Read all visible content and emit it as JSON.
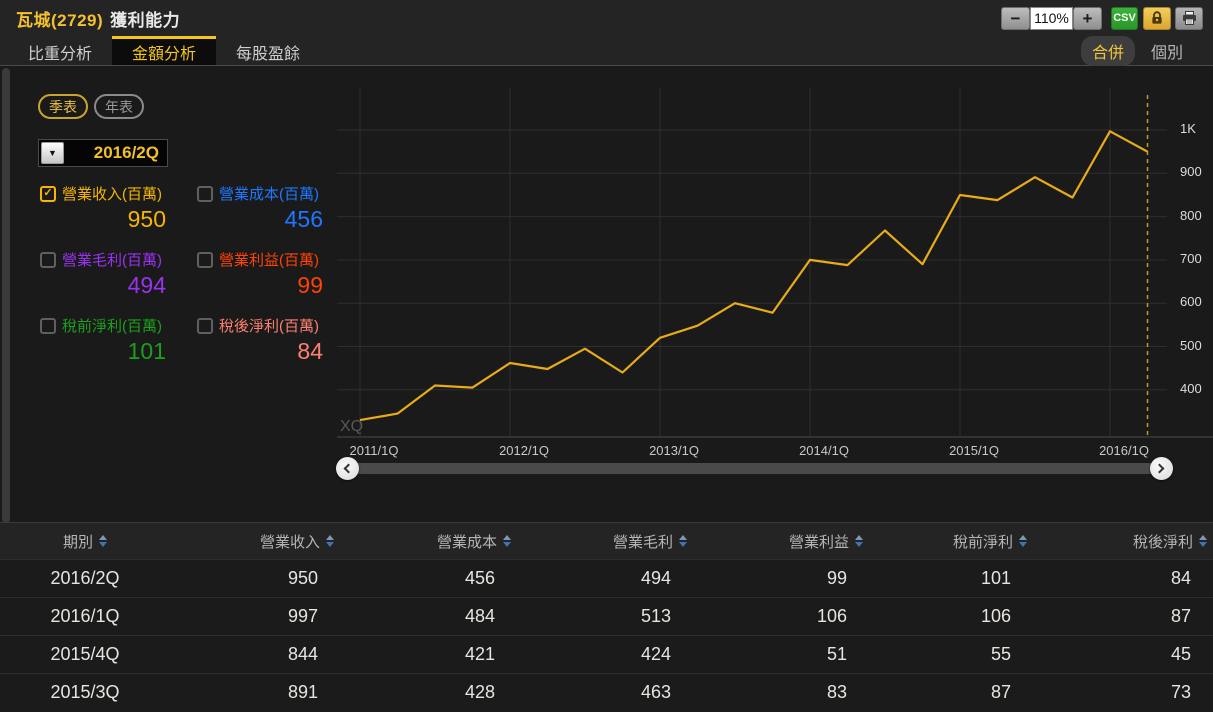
{
  "header": {
    "stock_name": "瓦城(2729)",
    "page_title": "獲利能力",
    "zoom_out": "−",
    "zoom_level": "110%",
    "zoom_in": "+",
    "csv_label": "CSV"
  },
  "tabs": [
    {
      "label": "比重分析",
      "active": false
    },
    {
      "label": "金額分析",
      "active": true
    },
    {
      "label": "每股盈餘",
      "active": false
    }
  ],
  "scope": {
    "merged": "合併",
    "individual": "個別"
  },
  "view_toggle": {
    "quarterly": "季表",
    "yearly": "年表"
  },
  "period_dropdown": {
    "value": "2016/2Q",
    "caret": "▼"
  },
  "check_glyph": "✓",
  "metrics": [
    {
      "label": "營業收入(百萬)",
      "value": "950",
      "color": "#f7b500",
      "checked": true
    },
    {
      "label": "營業成本(百萬)",
      "value": "456",
      "color": "#1e78ff",
      "checked": false
    },
    {
      "label": "營業毛利(百萬)",
      "value": "494",
      "color": "#9a32f0",
      "checked": false
    },
    {
      "label": "營業利益(百萬)",
      "value": "99",
      "color": "#ff4206",
      "checked": false
    },
    {
      "label": "稅前淨利(百萬)",
      "value": "101",
      "color": "#1aa01a",
      "checked": false
    },
    {
      "label": "稅後淨利(百萬)",
      "value": "84",
      "color": "#ff8070",
      "checked": false
    }
  ],
  "chart_data": {
    "type": "line",
    "watermark": "XQ",
    "grid": true,
    "x": [
      "2011/1Q",
      "2011/2Q",
      "2011/3Q",
      "2011/4Q",
      "2012/1Q",
      "2012/2Q",
      "2012/3Q",
      "2012/4Q",
      "2013/1Q",
      "2013/2Q",
      "2013/3Q",
      "2013/4Q",
      "2014/1Q",
      "2014/2Q",
      "2014/3Q",
      "2014/4Q",
      "2015/1Q",
      "2015/2Q",
      "2015/3Q",
      "2015/4Q",
      "2016/1Q",
      "2016/2Q"
    ],
    "series": [
      {
        "name": "營業收入(百萬)",
        "color": "#e9ab17",
        "values": [
          330,
          345,
          410,
          405,
          462,
          448,
          495,
          440,
          520,
          548,
          600,
          578,
          700,
          688,
          768,
          690,
          850,
          838,
          891,
          844,
          997,
          950
        ]
      }
    ],
    "x_ticks": [
      {
        "label": "2011/1Q",
        "index": 0
      },
      {
        "label": "2012/1Q",
        "index": 4
      },
      {
        "label": "2013/1Q",
        "index": 8
      },
      {
        "label": "2014/1Q",
        "index": 12
      },
      {
        "label": "2015/1Q",
        "index": 16
      },
      {
        "label": "2016/1Q",
        "index": 20
      }
    ],
    "y_axis": [
      {
        "label": "1K",
        "value": 1000
      },
      {
        "label": "900",
        "value": 900
      },
      {
        "label": "800",
        "value": 800
      },
      {
        "label": "700",
        "value": 700
      },
      {
        "label": "600",
        "value": 600
      },
      {
        "label": "500",
        "value": 500
      },
      {
        "label": "400",
        "value": 400
      }
    ],
    "ylim": [
      400,
      1000
    ],
    "highlight_index": 21,
    "highlight_label": "2016/2Q"
  },
  "table": {
    "headers": [
      "期別",
      "營業收入",
      "營業成本",
      "營業毛利",
      "營業利益",
      "稅前淨利",
      "稅後淨利"
    ],
    "rows": [
      [
        "2016/2Q",
        "950",
        "456",
        "494",
        "99",
        "101",
        "84"
      ],
      [
        "2016/1Q",
        "997",
        "484",
        "513",
        "106",
        "106",
        "87"
      ],
      [
        "2015/4Q",
        "844",
        "421",
        "424",
        "51",
        "55",
        "45"
      ],
      [
        "2015/3Q",
        "891",
        "428",
        "463",
        "83",
        "87",
        "73"
      ]
    ]
  }
}
